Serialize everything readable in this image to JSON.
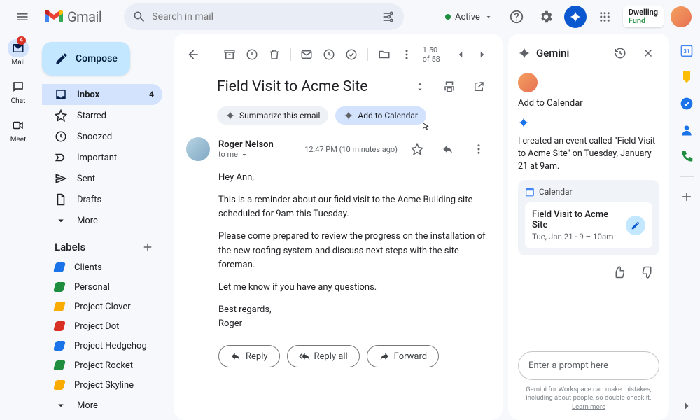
{
  "app": {
    "name": "Gmail"
  },
  "search": {
    "placeholder": "Search in mail"
  },
  "status": {
    "label": "Active"
  },
  "account": {
    "org_line1": "Dwelling",
    "org_line2": "Fund"
  },
  "rail": {
    "mail": "Mail",
    "mail_badge": "4",
    "chat": "Chat",
    "meet": "Meet"
  },
  "compose": "Compose",
  "nav": {
    "inbox": "Inbox",
    "inbox_count": "4",
    "starred": "Starred",
    "snoozed": "Snoozed",
    "important": "Important",
    "sent": "Sent",
    "drafts": "Drafts",
    "more": "More"
  },
  "labels": {
    "header": "Labels",
    "items": [
      {
        "name": "Clients",
        "color": "#1a73e8"
      },
      {
        "name": "Personal",
        "color": "#1e8e3e"
      },
      {
        "name": "Project Clover",
        "color": "#f9ab00"
      },
      {
        "name": "Project Dot",
        "color": "#d93025"
      },
      {
        "name": "Project Hedgehog",
        "color": "#1a73e8"
      },
      {
        "name": "Project Rocket",
        "color": "#1e8e3e"
      },
      {
        "name": "Project Skyline",
        "color": "#f9ab00"
      }
    ],
    "more": "More"
  },
  "toolbar": {
    "pagination": "1-50 of 58"
  },
  "email": {
    "subject": "Field Visit to Acme Site",
    "chip_summarize": "Summarize this email",
    "chip_add_cal": "Add to Calendar",
    "sender": "Roger Nelson",
    "to": "to me",
    "timestamp": "12:47 PM (10 minutes ago)",
    "body": {
      "greet": "Hey Ann,",
      "p1": "This is a reminder about our field visit to the Acme Building site scheduled for 9am this Tuesday.",
      "p2": "Please come prepared to review the progress on the installation of the new roofing system and discuss next steps with the site foreman.",
      "p3": "Let me know if you have any questions.",
      "signoff1": "Best regards,",
      "signoff2": "Roger"
    },
    "actions": {
      "reply": "Reply",
      "reply_all": "Reply all",
      "forward": "Forward"
    }
  },
  "gemini": {
    "title": "Gemini",
    "prompt_label": "Add to Calendar",
    "response": "I created an event called \"Field Visit to Acme Site\" on Tuesday, January 21 at 9am.",
    "cal_app": "Calendar",
    "event_title": "Field Visit to Acme Site",
    "event_time": "Tue, Jan 21 · 9 – 10am",
    "input_placeholder": "Enter a prompt here",
    "disclaimer_a": "Gemini for Workspace can make mistakes, including about people, so double-check it. ",
    "disclaimer_link": "Learn more"
  }
}
